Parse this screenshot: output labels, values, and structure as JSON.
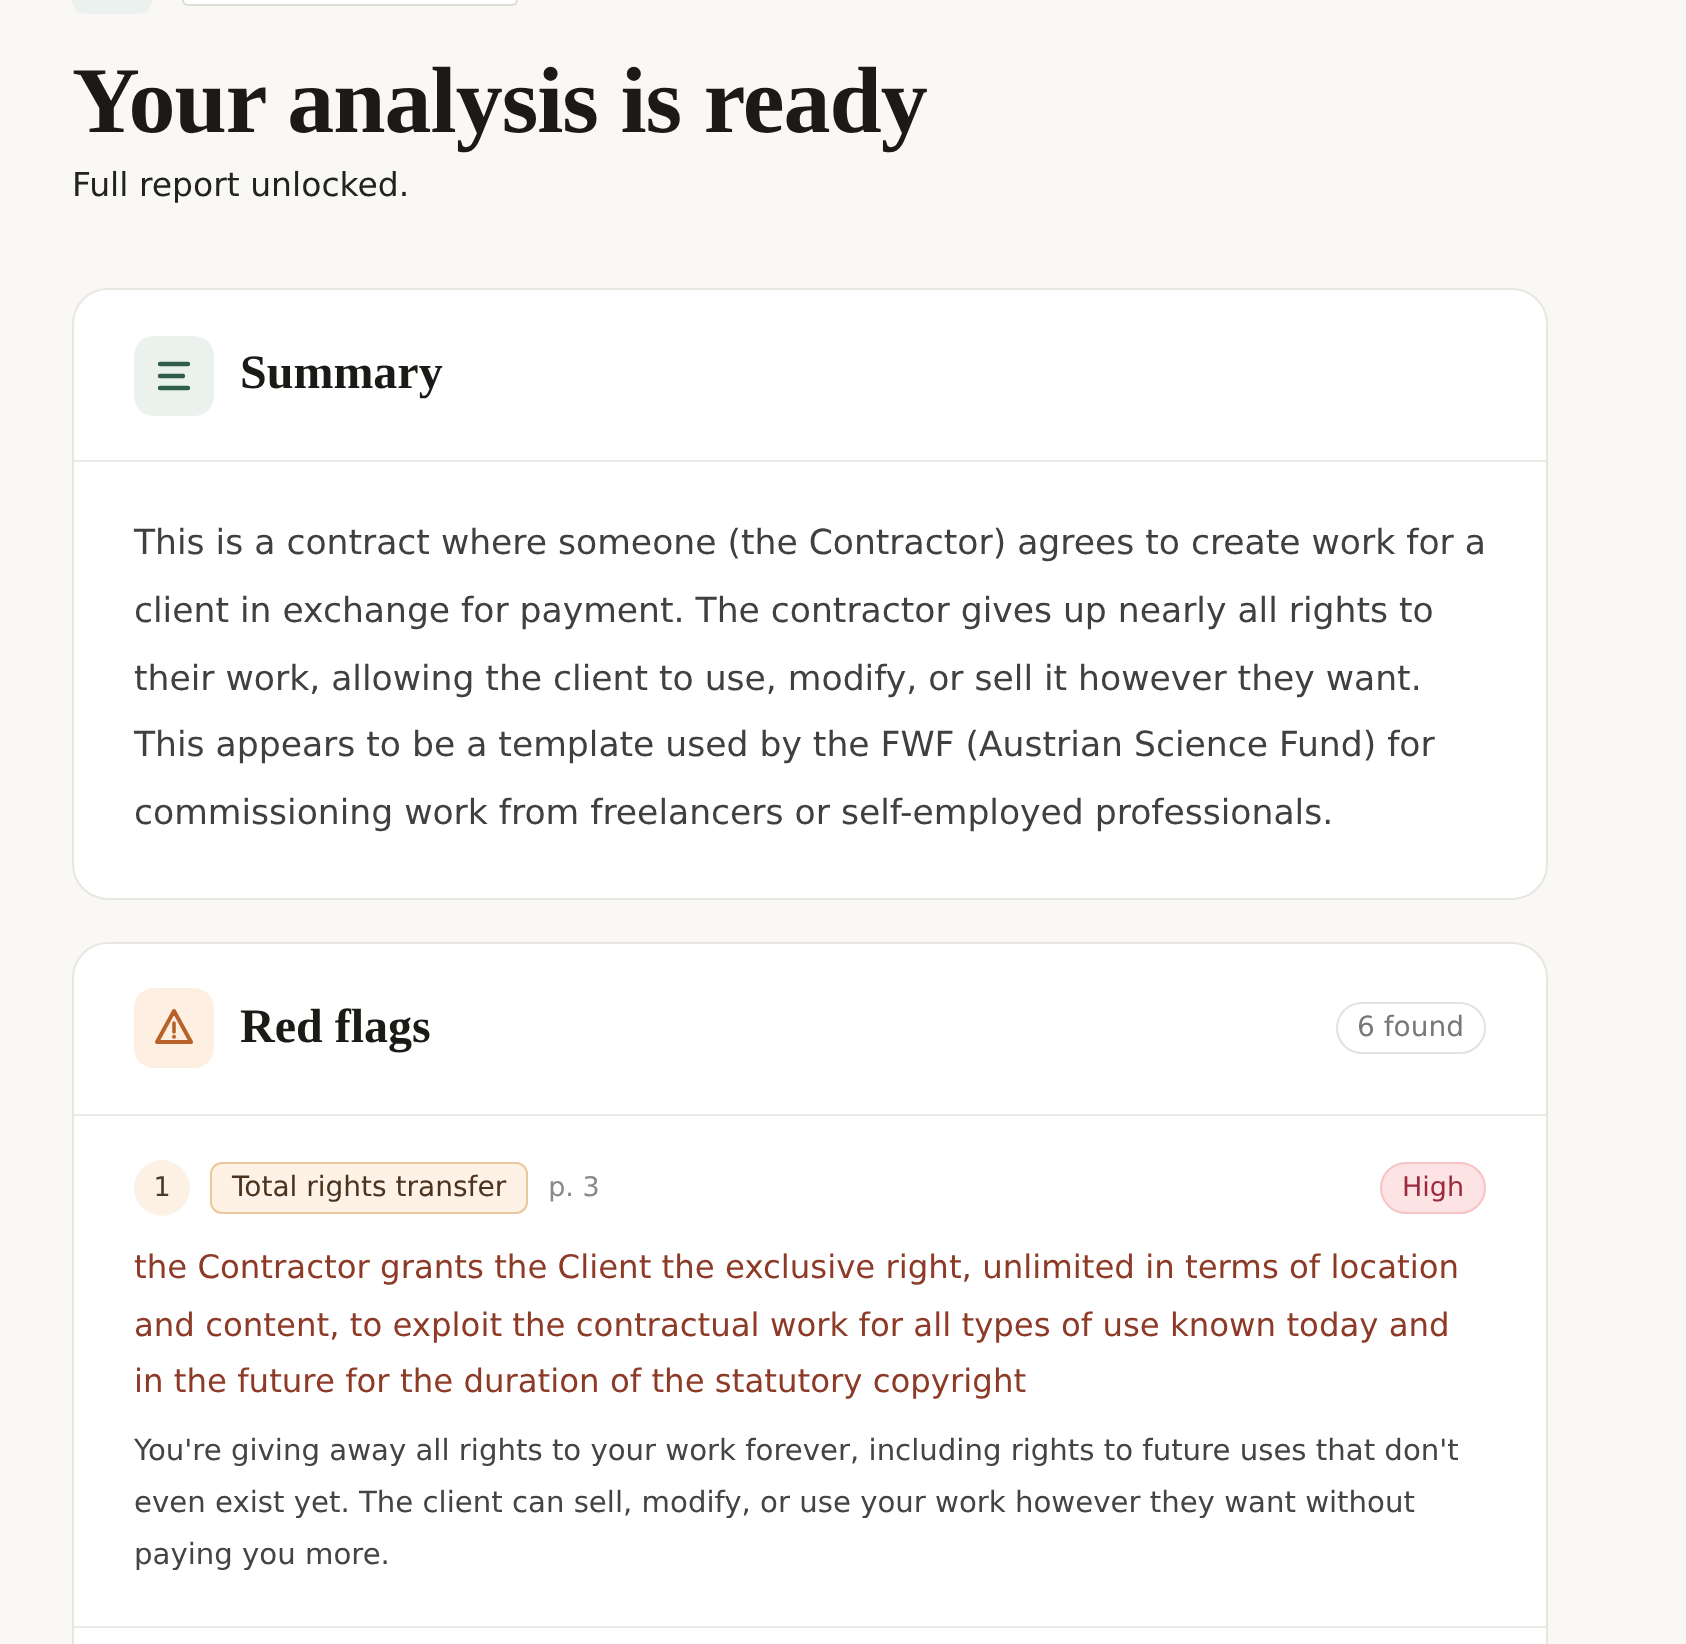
{
  "header": {
    "title": "Your analysis is ready",
    "subtitle": "Full report unlocked."
  },
  "summary": {
    "title": "Summary",
    "text": "This is a contract where someone (the Contractor) agrees to create work for a client in exchange for payment. The contractor gives up nearly all rights to their work, allowing the client to use, modify, or sell it however they want. This appears to be a template used by the FWF (Austrian Science Fund) for commissioning work from freelancers or self-employed professionals."
  },
  "red_flags": {
    "title": "Red flags",
    "count": "6 found",
    "items": [
      {
        "number": "1",
        "category": "Total rights transfer",
        "page": "p. 3",
        "severity": "High",
        "quote": "the Contractor grants the Client the exclusive right, unlimited in terms of location and content, to exploit the contractual work for all types of use known today and in the future for the duration of the statutory copyright",
        "explanation": "You're giving away all rights to your work forever, including rights to future uses that don't even exist yet. The client can sell, modify, or use your work however they want without paying you more."
      }
    ]
  }
}
